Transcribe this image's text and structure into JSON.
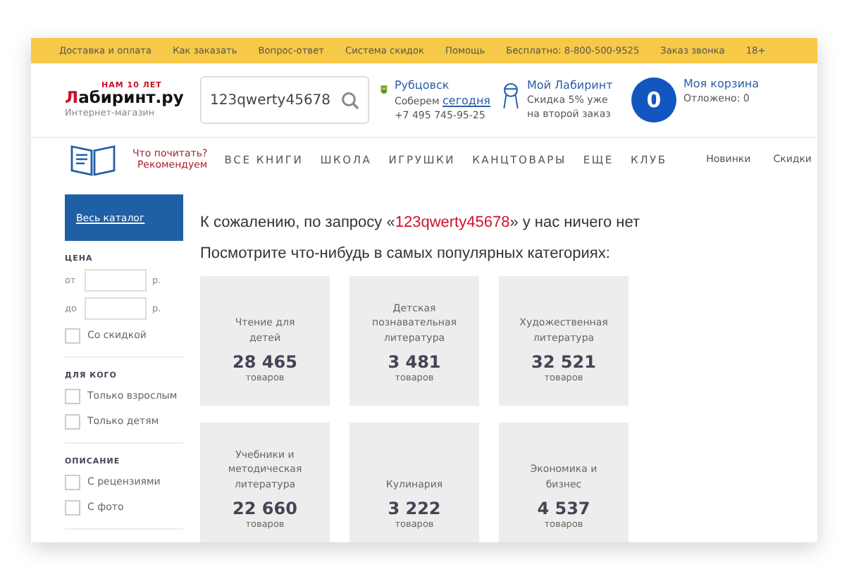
{
  "top_bar": {
    "links": [
      "Доставка и оплата",
      "Как заказать",
      "Вопрос-ответ",
      "Система скидок",
      "Помощь",
      "Бесплатно: 8-800-500-9525",
      "Заказ звонка",
      "18+"
    ]
  },
  "header": {
    "logo": {
      "tagline": "НАМ 10 ЛЕТ",
      "first_letter": "Л",
      "rest": "абиринт.ру",
      "subtitle": "Интернет-магазин"
    },
    "search": {
      "value": "123qwerty45678"
    },
    "city": {
      "name": "Рубцовск",
      "note": "Соберем",
      "note_link": "сегодня",
      "phone": "+7 495 745-95-25"
    },
    "account": {
      "title": "Мой Лабиринт",
      "note": "Скидка 5% уже на второй заказ"
    },
    "cart": {
      "count": "0",
      "title": "Моя корзина",
      "deferred": "Отложено: 0"
    }
  },
  "nav": {
    "recommend": [
      "Что почитать?",
      "Рекомендуем"
    ],
    "items": [
      "ВСЕ КНИГИ",
      "ШКОЛА",
      "ИГРУШКИ",
      "КАНЦТОВАРЫ",
      "ЕЩЕ",
      "КЛУБ"
    ],
    "small_items": [
      "Новинки",
      "Скидки"
    ]
  },
  "sidebar": {
    "catalog_button": "Весь каталог",
    "price": {
      "title": "ЦЕНА",
      "from": "от",
      "to": "до",
      "currency_from": "р.",
      "currency_to": "р.",
      "discount": {
        "label": "Со скидкой",
        "checked": false
      }
    },
    "groups": [
      {
        "title": "ДЛЯ КОГО",
        "options": [
          {
            "label": "Только взрослым",
            "checked": false
          },
          {
            "label": "Только детям",
            "checked": false
          }
        ]
      },
      {
        "title": "ОПИСАНИЕ",
        "options": [
          {
            "label": "С рецензиями",
            "checked": false
          },
          {
            "label": "С фото",
            "checked": false
          }
        ]
      }
    ]
  },
  "content": {
    "message": {
      "before": "К сожалению, по запросу «",
      "query": "123qwerty45678",
      "after": "» у нас ничего нет"
    },
    "subtitle": "Посмотрите что-нибудь в самых популярных категориях:",
    "categories": [
      {
        "name": "Чтение для детей",
        "count": "28 465",
        "unit": "товаров"
      },
      {
        "name": "Детская познавательная литература",
        "count": "3 481",
        "unit": "товаров"
      },
      {
        "name": "Художественная литература",
        "count": "32 521",
        "unit": "товаров"
      },
      {
        "name": "Учебники и методическая литература",
        "count": "22 660",
        "unit": "товаров"
      },
      {
        "name": "Кулинария",
        "count": "3 222",
        "unit": "товаров"
      },
      {
        "name": "Экономика и бизнес",
        "count": "4 537",
        "unit": "товаров"
      }
    ]
  }
}
